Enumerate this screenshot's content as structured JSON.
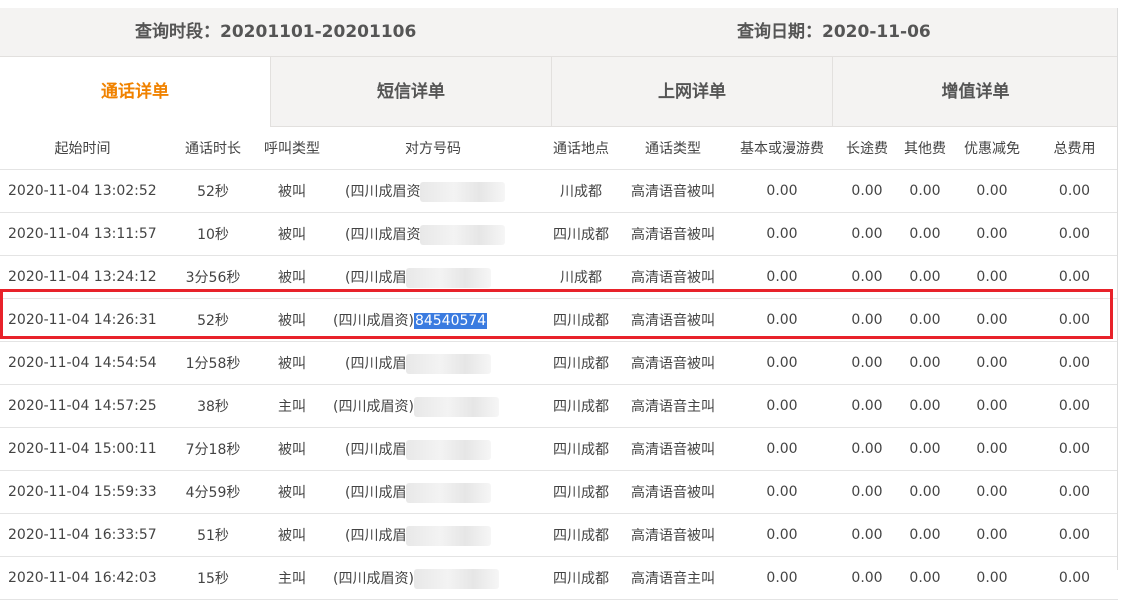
{
  "header": {
    "period_label": "查询时段：20201101-20201106",
    "date_label": "查询日期：2020-11-06"
  },
  "tabs": [
    {
      "label": "通话详单",
      "active": true
    },
    {
      "label": "短信详单",
      "active": false
    },
    {
      "label": "上网详单",
      "active": false
    },
    {
      "label": "增值详单",
      "active": false
    }
  ],
  "table": {
    "columns": [
      "起始时间",
      "通话时长",
      "呼叫类型",
      "对方号码",
      "通话地点",
      "通话类型",
      "基本或漫游费",
      "长途费",
      "其他费",
      "优惠减免",
      "总费用"
    ],
    "rows": [
      [
        "2020-11-04 13:02:52",
        "52秒",
        "被叫",
        "(四川成眉资",
        "",
        "川成都",
        "高清语音被叫",
        "0.00",
        "0.00",
        "0.00",
        "0.00",
        "0.00"
      ],
      [
        "2020-11-04 13:11:57",
        "10秒",
        "被叫",
        "(四川成眉资",
        "",
        "四川成都",
        "高清语音被叫",
        "0.00",
        "0.00",
        "0.00",
        "0.00",
        "0.00"
      ],
      [
        "2020-11-04 13:24:12",
        "3分56秒",
        "被叫",
        "(四川成眉",
        "",
        "川成都",
        "高清语音被叫",
        "0.00",
        "0.00",
        "0.00",
        "0.00",
        "0.00"
      ],
      [
        "2020-11-04 14:26:31",
        "52秒",
        "被叫",
        "(四川成眉资)",
        "84540574",
        "四川成都",
        "高清语音被叫",
        "0.00",
        "0.00",
        "0.00",
        "0.00",
        "0.00"
      ],
      [
        "2020-11-04 14:54:54",
        "1分58秒",
        "被叫",
        "(四川成眉",
        "",
        "四川成都",
        "高清语音被叫",
        "0.00",
        "0.00",
        "0.00",
        "0.00",
        "0.00"
      ],
      [
        "2020-11-04 14:57:25",
        "38秒",
        "主叫",
        "(四川成眉资)",
        "",
        "四川成都",
        "高清语音主叫",
        "0.00",
        "0.00",
        "0.00",
        "0.00",
        "0.00"
      ],
      [
        "2020-11-04 15:00:11",
        "7分18秒",
        "被叫",
        "(四川成眉",
        "",
        "四川成都",
        "高清语音被叫",
        "0.00",
        "0.00",
        "0.00",
        "0.00",
        "0.00"
      ],
      [
        "2020-11-04 15:59:33",
        "4分59秒",
        "被叫",
        "(四川成眉",
        "",
        "四川成都",
        "高清语音被叫",
        "0.00",
        "0.00",
        "0.00",
        "0.00",
        "0.00"
      ],
      [
        "2020-11-04 16:33:57",
        "51秒",
        "被叫",
        "(四川成眉",
        "",
        "四川成都",
        "高清语音被叫",
        "0.00",
        "0.00",
        "0.00",
        "0.00",
        "0.00"
      ],
      [
        "2020-11-04 16:42:03",
        "15秒",
        "主叫",
        "(四川成眉资)",
        "",
        "四川成都",
        "高清语音主叫",
        "0.00",
        "0.00",
        "0.00",
        "0.00",
        "0.00"
      ]
    ],
    "highlighted_row": 3,
    "colors": {
      "accent": "#f08200",
      "highlight_border": "#e8222a",
      "selection": "#3a7be0"
    }
  }
}
